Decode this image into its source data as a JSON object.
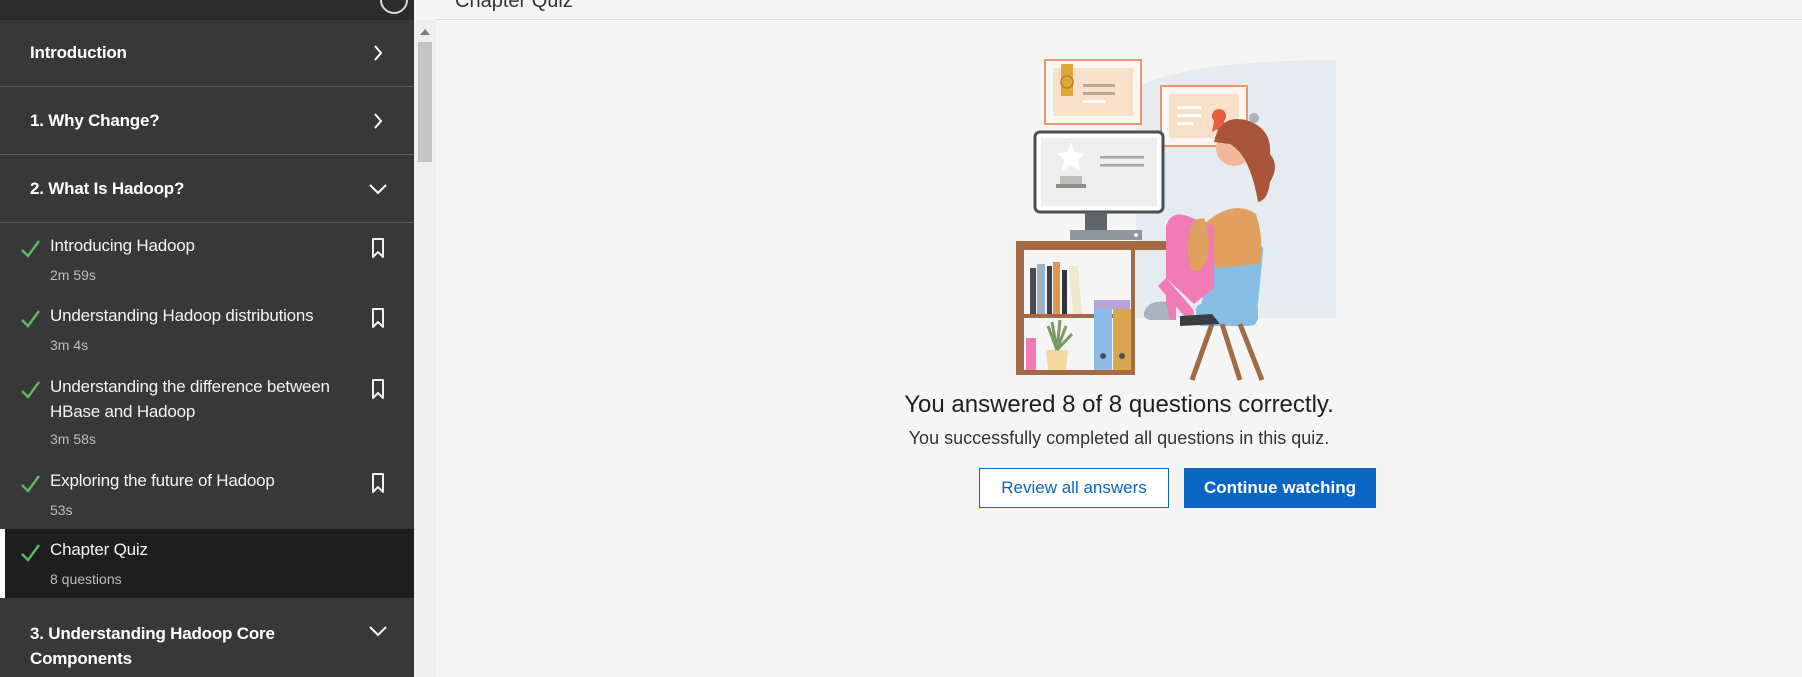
{
  "header": {
    "title": "Chapter Quiz"
  },
  "sidebar": {
    "sections": [
      {
        "title": "Introduction",
        "state": "collapsed"
      },
      {
        "title": "1. Why Change?",
        "state": "collapsed"
      },
      {
        "title": "2. What Is Hadoop?",
        "state": "expanded"
      },
      {
        "title": "3. Understanding Hadoop Core Components",
        "state": "expanded"
      }
    ],
    "lessons": [
      {
        "title": "Introducing Hadoop",
        "duration": "2m 59s",
        "completed": true
      },
      {
        "title": "Understanding Hadoop distributions",
        "duration": "3m 4s",
        "completed": true
      },
      {
        "title": "Understanding the difference between HBase and Hadoop",
        "duration": "3m 58s",
        "completed": true
      },
      {
        "title": "Exploring the future of Hadoop",
        "duration": "53s",
        "completed": true
      },
      {
        "title": "Chapter Quiz",
        "duration": "8 questions",
        "completed": true,
        "active": true
      }
    ],
    "icons": {
      "check": "check-icon",
      "bookmark": "bookmark-icon",
      "chevron_right": "chevron-right-icon",
      "chevron_down": "chevron-down-icon"
    }
  },
  "result": {
    "title": "You answered 8 of 8 questions correctly.",
    "subtitle": "You successfully completed all questions in this quiz.",
    "review_label": "Review all answers",
    "continue_label": "Continue watching"
  },
  "colors": {
    "accent": "#0a66c2",
    "check": "#5fb85f",
    "sidebar_bg": "#383838",
    "active_bg": "#1e1e1e"
  }
}
